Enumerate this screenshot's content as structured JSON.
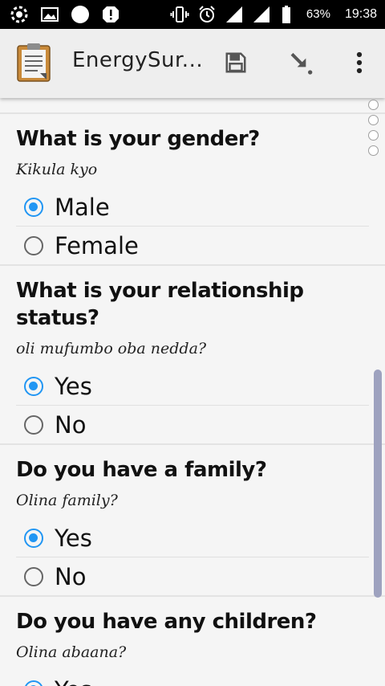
{
  "status_bar": {
    "battery_percent": "63%",
    "time": "19:38"
  },
  "app_bar": {
    "title": "EnergySur..."
  },
  "questions": [
    {
      "title": "What is your gender?",
      "hint": "Kikula kyo",
      "options": [
        {
          "label": "Male",
          "selected": true
        },
        {
          "label": "Female",
          "selected": false
        }
      ]
    },
    {
      "title": "What is your relationship status?",
      "hint": "oli mufumbo oba nedda?",
      "options": [
        {
          "label": "Yes",
          "selected": true
        },
        {
          "label": "No",
          "selected": false
        }
      ]
    },
    {
      "title": "Do you have a family?",
      "hint": "Olina family?",
      "options": [
        {
          "label": "Yes",
          "selected": true
        },
        {
          "label": "No",
          "selected": false
        }
      ]
    },
    {
      "title": "Do you have any children?",
      "hint": "Olina abaana?",
      "options": [
        {
          "label": "Yes",
          "selected": true
        }
      ]
    }
  ],
  "colors": {
    "accent": "#2196f3",
    "appbar": "#eeeeee",
    "statusbar": "#000000"
  }
}
